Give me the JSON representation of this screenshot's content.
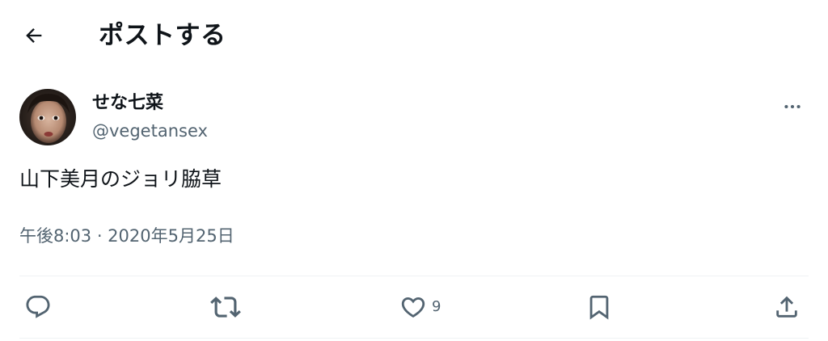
{
  "header": {
    "back_icon": "arrow-left-icon",
    "title": "ポストする"
  },
  "post": {
    "author": {
      "display_name": "せな七菜",
      "handle": "@vegetansex"
    },
    "text": "山下美月のジョリ脇草",
    "timestamp": "午後8:03 · 2020年5月25日"
  },
  "actions": {
    "reply_icon": "reply-icon",
    "repost_icon": "repost-icon",
    "like_icon": "heart-icon",
    "like_count": "9",
    "bookmark_icon": "bookmark-icon",
    "share_icon": "share-icon"
  },
  "colors": {
    "text_primary": "#0f1419",
    "text_secondary": "#536471",
    "divider": "#eff3f4"
  }
}
